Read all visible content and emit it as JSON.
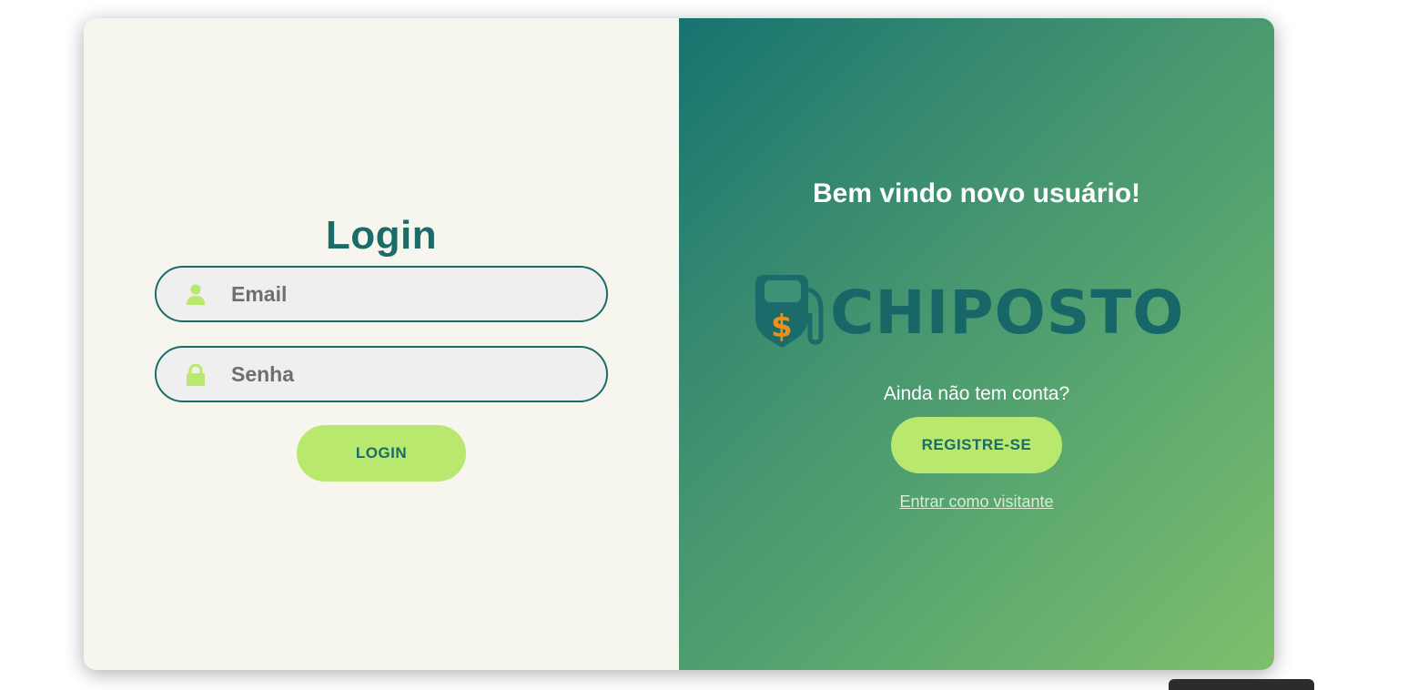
{
  "login_panel": {
    "title": "Login",
    "email_placeholder": "Email",
    "password_placeholder": "Senha",
    "login_button": "LOGIN"
  },
  "welcome_panel": {
    "heading": "Bem vindo novo usuário!",
    "logo_text": "CHIPOSTO",
    "question": "Ainda não tem conta?",
    "register_button": "REGISTRE-SE",
    "visitor_link": "Entrar como visitante"
  },
  "icons": {
    "email_field": "user-icon",
    "password_field": "lock-icon",
    "logo": "fuel-pump-dollar-icon"
  },
  "colors": {
    "primary": "#1b6b6a",
    "accent": "#b8e86e",
    "left_bg": "#f6f5ee",
    "gradient_start": "#177370",
    "gradient_end": "#7ebf6c",
    "dollar": "#e8901e"
  }
}
